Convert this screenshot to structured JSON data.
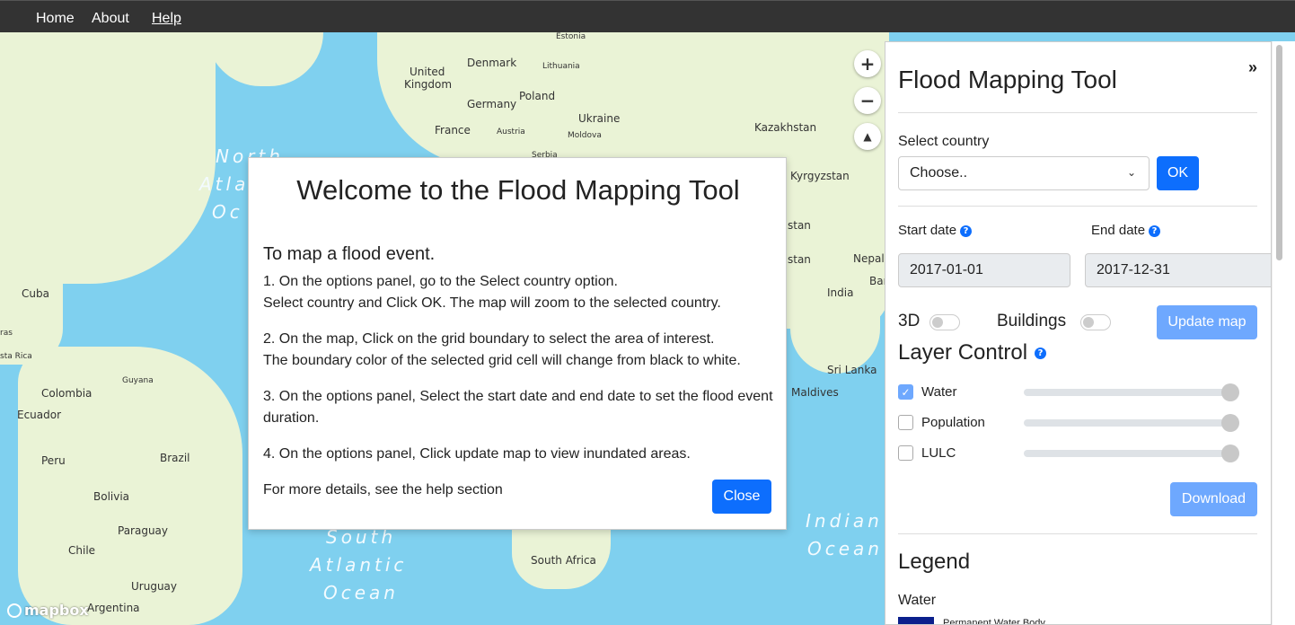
{
  "nav": {
    "home": "Home",
    "about": "About",
    "help": "Help"
  },
  "map": {
    "labels": {
      "estonia": "Estonia",
      "denmark": "Denmark",
      "lithuania": "Lithuania",
      "united_kingdom_1": "United",
      "united_kingdom_2": "Kingdom",
      "poland": "Poland",
      "germany": "Germany",
      "ukraine": "Ukraine",
      "france": "France",
      "austria": "Austria",
      "moldova": "Moldova",
      "kazakhstan": "Kazakhstan",
      "serbia": "Serbia",
      "kyrgyzstan": "Kyrgyzstan",
      "stan_1": "stan",
      "stan_2": "stan",
      "nepal": "Nepal",
      "ban": "Bar",
      "india": "India",
      "sri_lanka": "Sri Lanka",
      "maldives": "Maldives",
      "cuba": "Cuba",
      "ras": "ras",
      "sta_rica": "sta Rica",
      "guyana": "Guyana",
      "colombia": "Colombia",
      "ecuador": "Ecuador",
      "peru": "Peru",
      "brazil": "Brazil",
      "bolivia": "Bolivia",
      "paraguay": "Paraguay",
      "chile": "Chile",
      "uruguay": "Uruguay",
      "argentina": "Argentina",
      "south_africa": "South Africa"
    },
    "oceans": {
      "north_atlantic_1": "North",
      "north_atlantic_2": "Atla",
      "north_atlantic_3": "Oc",
      "south_atlantic_1": "South",
      "south_atlantic_2": "Atlantic",
      "south_atlantic_3": "Ocean",
      "indian_1": "Indian",
      "indian_2": "Ocean"
    },
    "zoom_in": "+",
    "zoom_out": "−",
    "compass": "▲",
    "attribution": "mapbox"
  },
  "modal": {
    "title": "Welcome to the Flood Mapping Tool",
    "subtitle": "To map a flood event.",
    "step1_line1": "1. On the options panel, go to the Select country option.",
    "step1_line2": "Select country and Click OK. The map will zoom to the selected country.",
    "step2_line1": "2. On the map, Click on the grid boundary to select the area of interest.",
    "step2_line2": "The boundary color of the selected grid cell will change from black to white.",
    "step3_line1": "3. On the options panel, Select the start date and end date to set the flood event",
    "step3_line2": "duration.",
    "step4": "4. On the options panel, Click update map to view inundated areas.",
    "more": "For more details, see the help section",
    "close": "Close"
  },
  "panel": {
    "title": "Flood Mapping Tool",
    "collapse": "»",
    "select_country_label": "Select country",
    "select_country_value": "Choose..",
    "ok": "OK",
    "start_date_label": "Start date",
    "end_date_label": "End date",
    "start_date": "2017-01-01",
    "end_date": "2017-12-31",
    "toggle_3d": "3D",
    "toggle_buildings": "Buildings",
    "update_map": "Update map",
    "layer_control": "Layer Control",
    "layers": [
      {
        "label": "Water",
        "checked": true,
        "opacity": 1.0
      },
      {
        "label": "Population",
        "checked": false,
        "opacity": 1.0
      },
      {
        "label": "LULC",
        "checked": false,
        "opacity": 1.0
      }
    ],
    "download": "Download",
    "legend_title": "Legend",
    "legend_water": "Water",
    "legend_item": "Permanent Water Body"
  },
  "colors": {
    "primary": "#0d6efd",
    "primary_light": "#6ea8fe",
    "navbar": "#333333",
    "ocean": "#7fd0ef",
    "land": "#eaf3d6"
  }
}
